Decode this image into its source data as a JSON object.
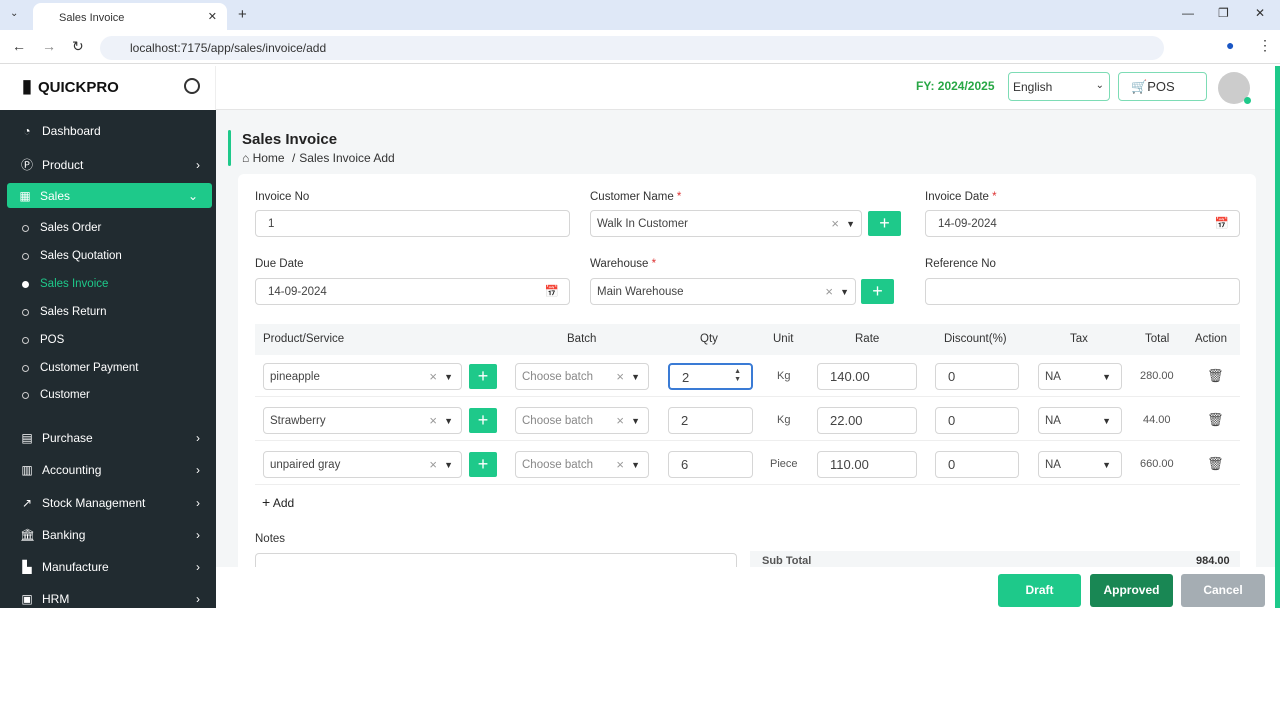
{
  "browser": {
    "tab_title": "Sales Invoice",
    "url": "localhost:7175/app/sales/invoice/add"
  },
  "app": {
    "logo": "QUICKPRO",
    "fy": "FY: 2024/2025",
    "language": "English",
    "pos": "POS"
  },
  "sidebar": {
    "items": [
      {
        "label": "Dashboard"
      },
      {
        "label": "Product"
      },
      {
        "label": "Sales"
      },
      {
        "label": "Purchase"
      },
      {
        "label": "Accounting"
      },
      {
        "label": "Stock Management"
      },
      {
        "label": "Banking"
      },
      {
        "label": "Manufacture"
      },
      {
        "label": "HRM"
      }
    ],
    "sales_sub": [
      {
        "label": "Sales Order"
      },
      {
        "label": "Sales Quotation"
      },
      {
        "label": "Sales Invoice"
      },
      {
        "label": "Sales Return"
      },
      {
        "label": "POS"
      },
      {
        "label": "Customer Payment"
      },
      {
        "label": "Customer"
      }
    ]
  },
  "page": {
    "title": "Sales Invoice",
    "crumb_home": "Home",
    "crumb_sep": "/",
    "crumb_current": "Sales Invoice Add"
  },
  "form": {
    "invoice_no_label": "Invoice No",
    "invoice_no": "1",
    "customer_label": "Customer Name",
    "customer": "Walk In Customer",
    "invoice_date_label": "Invoice Date",
    "invoice_date": "14-09-2024",
    "due_date_label": "Due Date",
    "due_date": "14-09-2024",
    "warehouse_label": "Warehouse",
    "warehouse": "Main Warehouse",
    "reference_label": "Reference No",
    "reference": "",
    "required": "*"
  },
  "table": {
    "headers": [
      "Product/Service",
      "Batch",
      "Qty",
      "Unit",
      "Rate",
      "Discount(%)",
      "Tax",
      "Total",
      "Action"
    ],
    "rows": [
      {
        "product": "pineapple",
        "batch": "Choose batch",
        "qty": "2",
        "unit": "Kg",
        "rate": "140.00",
        "discount": "0",
        "tax": "NA",
        "total": "280.00"
      },
      {
        "product": "Strawberry",
        "batch": "Choose batch",
        "qty": "2",
        "unit": "Kg",
        "rate": "22.00",
        "discount": "0",
        "tax": "NA",
        "total": "44.00"
      },
      {
        "product": "unpaired gray",
        "batch": "Choose batch",
        "qty": "6",
        "unit": "Piece",
        "rate": "110.00",
        "discount": "0",
        "tax": "NA",
        "total": "660.00"
      }
    ],
    "add": "Add"
  },
  "notes_label": "Notes",
  "subtotal_label": "Sub Total",
  "subtotal": "984.00",
  "buttons": {
    "draft": "Draft",
    "approved": "Approved",
    "cancel": "Cancel"
  }
}
